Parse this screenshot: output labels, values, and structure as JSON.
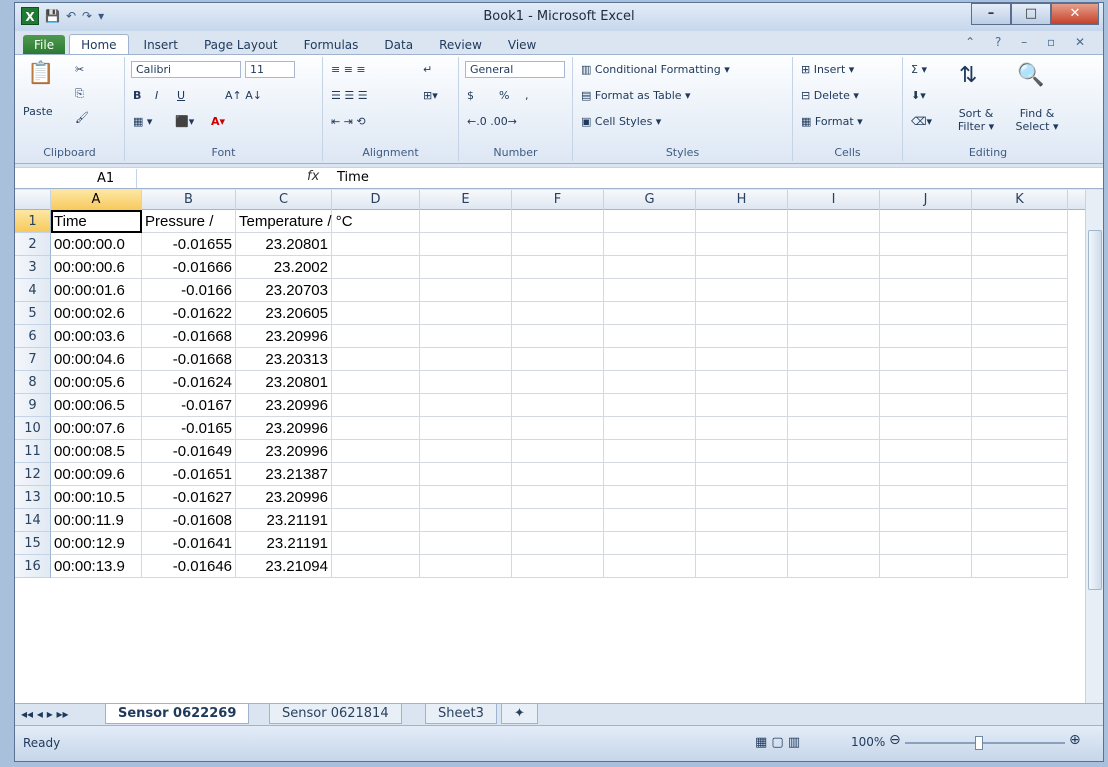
{
  "window": {
    "title": "Book1 - Microsoft Excel",
    "app_icon": "X"
  },
  "qat": {
    "save": "💾",
    "undo": "↶",
    "redo": "↷",
    "more": "▾"
  },
  "tabs": [
    "File",
    "Home",
    "Insert",
    "Page Layout",
    "Formulas",
    "Data",
    "Review",
    "View"
  ],
  "ribbon": {
    "clipboard": {
      "paste": "Paste",
      "label": "Clipboard"
    },
    "font": {
      "name": "Calibri",
      "size": "11",
      "label": "Font",
      "bold": "B",
      "italic": "I",
      "underline": "U"
    },
    "alignment": {
      "label": "Alignment"
    },
    "number": {
      "format": "General",
      "currency": "$",
      "percent": "%",
      "comma": ",",
      "label": "Number"
    },
    "styles": {
      "conditional": "Conditional Formatting ▾",
      "table": "Format as Table ▾",
      "cell": "Cell Styles ▾",
      "label": "Styles"
    },
    "cells": {
      "insert": "Insert ▾",
      "delete": "Delete ▾",
      "format": "Format ▾",
      "label": "Cells"
    },
    "editing": {
      "sigma": "Σ ▾",
      "sort": "Sort & Filter ▾",
      "find": "Find & Select ▾",
      "label": "Editing"
    }
  },
  "formula_bar": {
    "name_box": "A1",
    "fx": "fx",
    "content": "Time"
  },
  "columns": [
    "A",
    "B",
    "C",
    "D",
    "E",
    "F",
    "G",
    "H",
    "I",
    "J",
    "K"
  ],
  "rows": [
    {
      "n": "1",
      "a": "Time",
      "b": "Pressure /",
      "c": "Temperature / °C"
    },
    {
      "n": "2",
      "a": "00:00:00.0",
      "b": "-0.01655",
      "c": "23.20801"
    },
    {
      "n": "3",
      "a": "00:00:00.6",
      "b": "-0.01666",
      "c": "23.2002"
    },
    {
      "n": "4",
      "a": "00:00:01.6",
      "b": "-0.0166",
      "c": "23.20703"
    },
    {
      "n": "5",
      "a": "00:00:02.6",
      "b": "-0.01622",
      "c": "23.20605"
    },
    {
      "n": "6",
      "a": "00:00:03.6",
      "b": "-0.01668",
      "c": "23.20996"
    },
    {
      "n": "7",
      "a": "00:00:04.6",
      "b": "-0.01668",
      "c": "23.20313"
    },
    {
      "n": "8",
      "a": "00:00:05.6",
      "b": "-0.01624",
      "c": "23.20801"
    },
    {
      "n": "9",
      "a": "00:00:06.5",
      "b": "-0.0167",
      "c": "23.20996"
    },
    {
      "n": "10",
      "a": "00:00:07.6",
      "b": "-0.0165",
      "c": "23.20996"
    },
    {
      "n": "11",
      "a": "00:00:08.5",
      "b": "-0.01649",
      "c": "23.20996"
    },
    {
      "n": "12",
      "a": "00:00:09.6",
      "b": "-0.01651",
      "c": "23.21387"
    },
    {
      "n": "13",
      "a": "00:00:10.5",
      "b": "-0.01627",
      "c": "23.20996"
    },
    {
      "n": "14",
      "a": "00:00:11.9",
      "b": "-0.01608",
      "c": "23.21191"
    },
    {
      "n": "15",
      "a": "00:00:12.9",
      "b": "-0.01641",
      "c": "23.21191"
    },
    {
      "n": "16",
      "a": "00:00:13.9",
      "b": "-0.01646",
      "c": "23.21094"
    }
  ],
  "sheets": [
    "Sensor 0622269",
    "Sensor 0621814",
    "Sheet3"
  ],
  "status": {
    "ready": "Ready",
    "zoom": "100%"
  }
}
